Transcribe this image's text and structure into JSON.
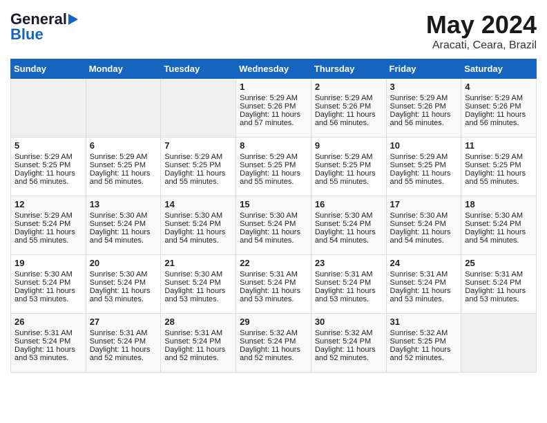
{
  "header": {
    "logo_general": "General",
    "logo_blue": "Blue",
    "month_title": "May 2024",
    "location": "Aracati, Ceara, Brazil"
  },
  "days_of_week": [
    "Sunday",
    "Monday",
    "Tuesday",
    "Wednesday",
    "Thursday",
    "Friday",
    "Saturday"
  ],
  "weeks": [
    [
      {
        "day": "",
        "info": ""
      },
      {
        "day": "",
        "info": ""
      },
      {
        "day": "",
        "info": ""
      },
      {
        "day": "1",
        "info": "Sunrise: 5:29 AM\nSunset: 5:26 PM\nDaylight: 11 hours\nand 57 minutes."
      },
      {
        "day": "2",
        "info": "Sunrise: 5:29 AM\nSunset: 5:26 PM\nDaylight: 11 hours\nand 56 minutes."
      },
      {
        "day": "3",
        "info": "Sunrise: 5:29 AM\nSunset: 5:26 PM\nDaylight: 11 hours\nand 56 minutes."
      },
      {
        "day": "4",
        "info": "Sunrise: 5:29 AM\nSunset: 5:26 PM\nDaylight: 11 hours\nand 56 minutes."
      }
    ],
    [
      {
        "day": "5",
        "info": "Sunrise: 5:29 AM\nSunset: 5:25 PM\nDaylight: 11 hours\nand 56 minutes."
      },
      {
        "day": "6",
        "info": "Sunrise: 5:29 AM\nSunset: 5:25 PM\nDaylight: 11 hours\nand 56 minutes."
      },
      {
        "day": "7",
        "info": "Sunrise: 5:29 AM\nSunset: 5:25 PM\nDaylight: 11 hours\nand 55 minutes."
      },
      {
        "day": "8",
        "info": "Sunrise: 5:29 AM\nSunset: 5:25 PM\nDaylight: 11 hours\nand 55 minutes."
      },
      {
        "day": "9",
        "info": "Sunrise: 5:29 AM\nSunset: 5:25 PM\nDaylight: 11 hours\nand 55 minutes."
      },
      {
        "day": "10",
        "info": "Sunrise: 5:29 AM\nSunset: 5:25 PM\nDaylight: 11 hours\nand 55 minutes."
      },
      {
        "day": "11",
        "info": "Sunrise: 5:29 AM\nSunset: 5:25 PM\nDaylight: 11 hours\nand 55 minutes."
      }
    ],
    [
      {
        "day": "12",
        "info": "Sunrise: 5:29 AM\nSunset: 5:24 PM\nDaylight: 11 hours\nand 55 minutes."
      },
      {
        "day": "13",
        "info": "Sunrise: 5:30 AM\nSunset: 5:24 PM\nDaylight: 11 hours\nand 54 minutes."
      },
      {
        "day": "14",
        "info": "Sunrise: 5:30 AM\nSunset: 5:24 PM\nDaylight: 11 hours\nand 54 minutes."
      },
      {
        "day": "15",
        "info": "Sunrise: 5:30 AM\nSunset: 5:24 PM\nDaylight: 11 hours\nand 54 minutes."
      },
      {
        "day": "16",
        "info": "Sunrise: 5:30 AM\nSunset: 5:24 PM\nDaylight: 11 hours\nand 54 minutes."
      },
      {
        "day": "17",
        "info": "Sunrise: 5:30 AM\nSunset: 5:24 PM\nDaylight: 11 hours\nand 54 minutes."
      },
      {
        "day": "18",
        "info": "Sunrise: 5:30 AM\nSunset: 5:24 PM\nDaylight: 11 hours\nand 54 minutes."
      }
    ],
    [
      {
        "day": "19",
        "info": "Sunrise: 5:30 AM\nSunset: 5:24 PM\nDaylight: 11 hours\nand 53 minutes."
      },
      {
        "day": "20",
        "info": "Sunrise: 5:30 AM\nSunset: 5:24 PM\nDaylight: 11 hours\nand 53 minutes."
      },
      {
        "day": "21",
        "info": "Sunrise: 5:30 AM\nSunset: 5:24 PM\nDaylight: 11 hours\nand 53 minutes."
      },
      {
        "day": "22",
        "info": "Sunrise: 5:31 AM\nSunset: 5:24 PM\nDaylight: 11 hours\nand 53 minutes."
      },
      {
        "day": "23",
        "info": "Sunrise: 5:31 AM\nSunset: 5:24 PM\nDaylight: 11 hours\nand 53 minutes."
      },
      {
        "day": "24",
        "info": "Sunrise: 5:31 AM\nSunset: 5:24 PM\nDaylight: 11 hours\nand 53 minutes."
      },
      {
        "day": "25",
        "info": "Sunrise: 5:31 AM\nSunset: 5:24 PM\nDaylight: 11 hours\nand 53 minutes."
      }
    ],
    [
      {
        "day": "26",
        "info": "Sunrise: 5:31 AM\nSunset: 5:24 PM\nDaylight: 11 hours\nand 53 minutes."
      },
      {
        "day": "27",
        "info": "Sunrise: 5:31 AM\nSunset: 5:24 PM\nDaylight: 11 hours\nand 52 minutes."
      },
      {
        "day": "28",
        "info": "Sunrise: 5:31 AM\nSunset: 5:24 PM\nDaylight: 11 hours\nand 52 minutes."
      },
      {
        "day": "29",
        "info": "Sunrise: 5:32 AM\nSunset: 5:24 PM\nDaylight: 11 hours\nand 52 minutes."
      },
      {
        "day": "30",
        "info": "Sunrise: 5:32 AM\nSunset: 5:24 PM\nDaylight: 11 hours\nand 52 minutes."
      },
      {
        "day": "31",
        "info": "Sunrise: 5:32 AM\nSunset: 5:25 PM\nDaylight: 11 hours\nand 52 minutes."
      },
      {
        "day": "",
        "info": ""
      }
    ]
  ]
}
